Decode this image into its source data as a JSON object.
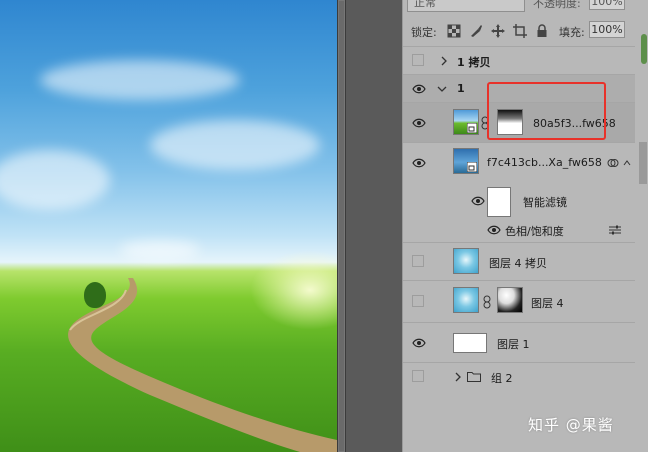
{
  "panel": {
    "blend_mode": "正常",
    "opacity_label": "不透明度:",
    "opacity_value": "100%",
    "lock_label": "锁定:",
    "fill_label": "填充:",
    "fill_value": "100%"
  },
  "layers": [
    {
      "name": "1 拷贝",
      "visible": false,
      "type": "group",
      "expanded": false
    },
    {
      "name": "1",
      "visible": true,
      "type": "group",
      "expanded": true
    },
    {
      "name": "80a5f3...fw658",
      "visible": true,
      "type": "smart-object-with-mask",
      "selected": true
    },
    {
      "name": "f7c413cb...Xa_fw658",
      "visible": true,
      "type": "smart-object"
    },
    {
      "name": "智能滤镜",
      "visible": true,
      "type": "smart-filter"
    },
    {
      "name": "色相/饱和度",
      "visible": true,
      "type": "filter-effect"
    },
    {
      "name": "图层 4 拷贝",
      "visible": false,
      "type": "pixel"
    },
    {
      "name": "图层 4",
      "visible": false,
      "type": "pixel-with-mask"
    },
    {
      "name": "图层 1",
      "visible": true,
      "type": "pixel"
    },
    {
      "name": "组 2",
      "visible": false,
      "type": "group",
      "expanded": false
    }
  ],
  "watermark": "知乎 @果酱",
  "colors": {
    "highlight": "#e8322a",
    "panel_bg": "#b8b8b8"
  }
}
